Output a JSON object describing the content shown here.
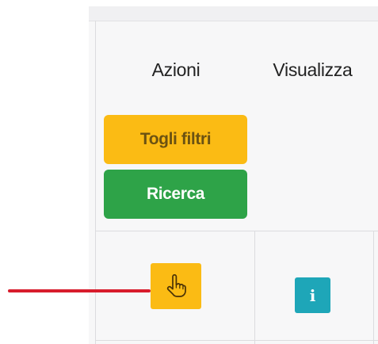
{
  "table": {
    "headers": {
      "actions": "Azioni",
      "view": "Visualizza"
    },
    "filter_buttons": {
      "clear_filters": "Togli filtri",
      "search": "Ricerca"
    },
    "row_icons": {
      "select": "hand-pointer-icon",
      "info": "info-icon",
      "info_glyph": "i"
    }
  },
  "colors": {
    "yellow_button": "#fbbb14",
    "green_button": "#2ea348",
    "info_button": "#1ea6b8",
    "annotation_arrow": "#d81c2c"
  }
}
